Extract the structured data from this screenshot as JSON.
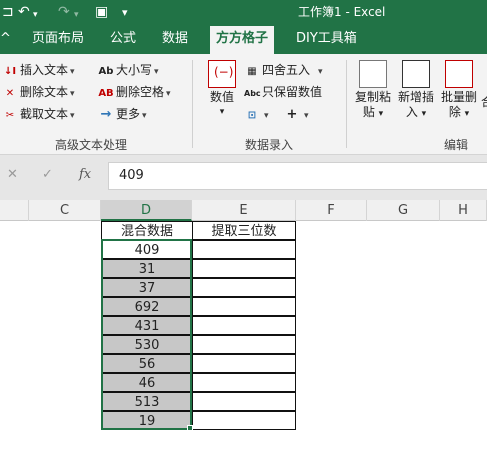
{
  "title_bar": {
    "title": "工作簿1  -  Excel"
  },
  "tabs": [
    "页面布局",
    "公式",
    "数据",
    "方方格子",
    "DIY工具箱"
  ],
  "active_tab": "方方格子",
  "ribbon": {
    "text_group": {
      "name": "高级文本处理",
      "items": [
        "插入文本",
        "删除文本",
        "截取文本",
        "大小写",
        "删除空格",
        "更多"
      ]
    },
    "entry_group": {
      "name": "数据录入",
      "big_button": "数值",
      "items": [
        "四舍五入",
        "只保留数值"
      ]
    },
    "edit_group": {
      "name": "编辑",
      "buttons": [
        "复制粘贴",
        "新增插入",
        "批量删除"
      ],
      "button_lines": [
        [
          "复制粘",
          "贴"
        ],
        [
          "新增插",
          "入"
        ],
        [
          "批量删",
          "除"
        ]
      ],
      "partial": "合"
    }
  },
  "formula_bar": {
    "value": "409",
    "fx_label": "fx"
  },
  "columns": [
    "C",
    "D",
    "E",
    "F",
    "G",
    "H"
  ],
  "selected_column": "D",
  "sheet": {
    "header_d": "混合数据",
    "header_e": "提取三位数",
    "values": [
      "409",
      "31",
      "37",
      "692",
      "431",
      "530",
      "56",
      "46",
      "513",
      "19"
    ]
  },
  "colors": {
    "accent": "#217346",
    "selected_fill": "#c7c7c7"
  },
  "icons": [
    "undo-icon",
    "redo-icon",
    "save-icon",
    "close-icon",
    "check-icon",
    "fx-icon"
  ]
}
